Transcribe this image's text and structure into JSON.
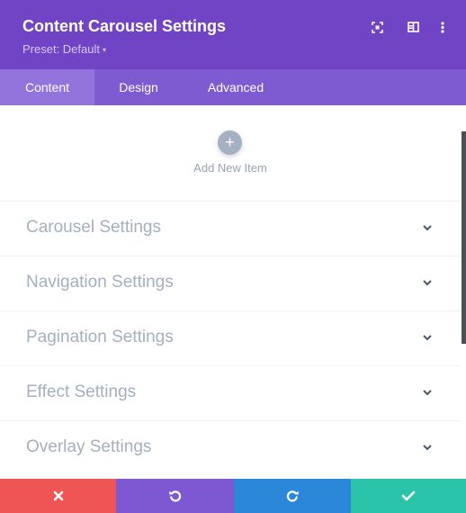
{
  "header": {
    "title": "Content Carousel Settings",
    "preset_label": "Preset: Default",
    "preset_caret": "▾",
    "icons": [
      "expand-icon",
      "split-view-icon",
      "more-options-icon"
    ],
    "background": "#7044c4"
  },
  "tabs": [
    {
      "label": "Content",
      "active": true
    },
    {
      "label": "Design",
      "active": false
    },
    {
      "label": "Advanced",
      "active": false
    }
  ],
  "add_item": {
    "plus": "+",
    "label": "Add New Item"
  },
  "sections": [
    {
      "label": "Carousel Settings"
    },
    {
      "label": "Navigation Settings"
    },
    {
      "label": "Pagination Settings"
    },
    {
      "label": "Effect Settings"
    },
    {
      "label": "Overlay Settings"
    }
  ],
  "footer": {
    "buttons": [
      {
        "name": "cancel",
        "icon": "close-icon",
        "color": "#ef5555"
      },
      {
        "name": "undo",
        "icon": "undo-icon",
        "color": "#7e57d2"
      },
      {
        "name": "redo",
        "icon": "redo-icon",
        "color": "#2b87da"
      },
      {
        "name": "save",
        "icon": "check-icon",
        "color": "#29c4a9"
      }
    ]
  }
}
